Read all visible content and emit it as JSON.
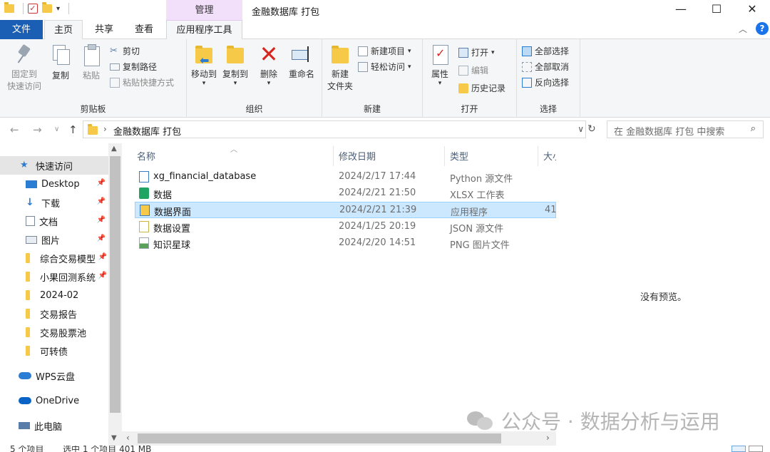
{
  "window": {
    "title": "金融数据库 打包",
    "manage_tab": "管理",
    "minimize": "—",
    "maximize": "☐",
    "close": "✕"
  },
  "tabs": {
    "file": "文件",
    "home": "主页",
    "share": "共享",
    "view": "查看",
    "app_tools": "应用程序工具"
  },
  "ribbon": {
    "clipboard": {
      "label": "剪贴板",
      "pin_line1": "固定到",
      "pin_line2": "快速访问",
      "copy": "复制",
      "paste": "粘贴",
      "cut": "剪切",
      "copy_path": "复制路径",
      "paste_shortcut": "粘贴快捷方式"
    },
    "organize": {
      "label": "组织",
      "move_to": "移动到",
      "copy_to": "复制到",
      "delete": "删除",
      "rename": "重命名"
    },
    "new": {
      "label": "新建",
      "new_folder_line1": "新建",
      "new_folder_line2": "文件夹",
      "new_item": "新建项目",
      "easy_access": "轻松访问"
    },
    "open": {
      "label": "打开",
      "properties": "属性",
      "open": "打开",
      "edit": "编辑",
      "history": "历史记录"
    },
    "select": {
      "label": "选择",
      "select_all": "全部选择",
      "select_none": "全部取消",
      "invert": "反向选择"
    }
  },
  "address": {
    "path": "金融数据库 打包",
    "search_placeholder": "在 金融数据库 打包 中搜索"
  },
  "nav": {
    "items": [
      {
        "label": "快速访问",
        "icon": "star-icon",
        "pinned": false,
        "selected": true
      },
      {
        "label": "Desktop",
        "icon": "desktop-icon",
        "pinned": true
      },
      {
        "label": "下载",
        "icon": "download-icon",
        "pinned": true
      },
      {
        "label": "文档",
        "icon": "document-icon",
        "pinned": true
      },
      {
        "label": "图片",
        "icon": "picture-icon",
        "pinned": true
      },
      {
        "label": "综合交易模型",
        "icon": "folder-icon",
        "pinned": true
      },
      {
        "label": "小果回测系统",
        "icon": "folder-icon",
        "pinned": true
      },
      {
        "label": "2024-02",
        "icon": "folder-icon",
        "pinned": false
      },
      {
        "label": "交易报告",
        "icon": "folder-icon",
        "pinned": false
      },
      {
        "label": "交易股票池",
        "icon": "folder-icon",
        "pinned": false
      },
      {
        "label": "可转债",
        "icon": "folder-icon",
        "pinned": false
      },
      {
        "label": "WPS云盘",
        "icon": "cloud-icon",
        "pinned": false
      },
      {
        "label": "OneDrive",
        "icon": "onedrive-icon",
        "pinned": false
      },
      {
        "label": "此电脑",
        "icon": "computer-icon",
        "pinned": false
      }
    ]
  },
  "files": {
    "columns": {
      "name": "名称",
      "date": "修改日期",
      "type": "类型",
      "size": "大小"
    },
    "rows": [
      {
        "name": "xg_financial_database",
        "date": "2024/2/17 17:44",
        "type": "Python 源文件",
        "size": "",
        "icon": "python-file-icon",
        "icon_color": "#3b7bbf"
      },
      {
        "name": "数据",
        "date": "2024/2/21 21:50",
        "type": "XLSX 工作表",
        "size": "",
        "icon": "xlsx-file-icon",
        "icon_color": "#1fa463"
      },
      {
        "name": "数据界面",
        "date": "2024/2/21 21:39",
        "type": "应用程序",
        "size": "41",
        "icon": "exe-file-icon",
        "icon_color": "#3b7bbf",
        "selected": true
      },
      {
        "name": "数据设置",
        "date": "2024/1/25 20:19",
        "type": "JSON 源文件",
        "size": "",
        "icon": "json-file-icon",
        "icon_color": "#c9b44a"
      },
      {
        "name": "知识星球",
        "date": "2024/2/20 14:51",
        "type": "PNG 图片文件",
        "size": "",
        "icon": "png-file-icon",
        "icon_color": "#5aa05a"
      }
    ]
  },
  "preview": {
    "text": "没有预览。"
  },
  "watermark": {
    "text": "公众号 · 数据分析与运用"
  },
  "status": {
    "count": "5 个项目",
    "selected": "选中 1 个项目  401 MB"
  },
  "colors": {
    "file_tab": "#1a5fb4",
    "manage_tab": "#f2dffa",
    "selection": "#cce8ff"
  }
}
